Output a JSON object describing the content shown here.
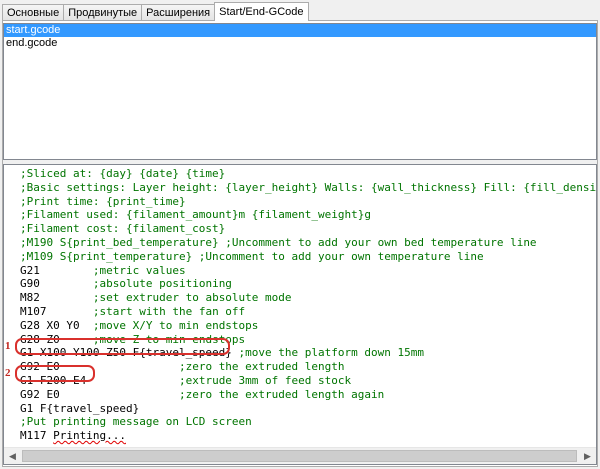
{
  "tabs": [
    {
      "label": "Основные",
      "active": false
    },
    {
      "label": "Продвинутые",
      "active": false
    },
    {
      "label": "Расширения",
      "active": false
    },
    {
      "label": "Start/End-GCode",
      "active": true
    }
  ],
  "files": [
    {
      "name": "start.gcode",
      "selected": true
    },
    {
      "name": "end.gcode",
      "selected": false
    }
  ],
  "code_lines": [
    {
      "code": "",
      "comment": ";Sliced at: {day} {date} {time}"
    },
    {
      "code": "",
      "comment": ";Basic settings: Layer height: {layer_height} Walls: {wall_thickness} Fill: {fill_density}"
    },
    {
      "code": "",
      "comment": ";Print time: {print_time}"
    },
    {
      "code": "",
      "comment": ";Filament used: {filament_amount}m {filament_weight}g"
    },
    {
      "code": "",
      "comment": ";Filament cost: {filament_cost}"
    },
    {
      "code": "",
      "comment": ";M190 S{print_bed_temperature} ;Uncomment to add your own bed temperature line"
    },
    {
      "code": "",
      "comment": ";M109 S{print_temperature} ;Uncomment to add your own temperature line"
    },
    {
      "code": "G21        ",
      "comment": ";metric values"
    },
    {
      "code": "G90        ",
      "comment": ";absolute positioning"
    },
    {
      "code": "M82        ",
      "comment": ";set extruder to absolute mode"
    },
    {
      "code": "M107       ",
      "comment": ";start with the fan off"
    },
    {
      "code": "G28 X0 Y0  ",
      "comment": ";move X/Y to min endstops"
    },
    {
      "code": "G28 Z0     ",
      "comment": ";move Z to min endstops"
    },
    {
      "code": "G1 X100 Y100 Z50 F{travel_speed} ",
      "comment": ";move the platform down 15mm"
    },
    {
      "code": "G92 E0                  ",
      "comment": ";zero the extruded length"
    },
    {
      "code": "G1 F200 E4              ",
      "comment": ";extrude 3mm of feed stock"
    },
    {
      "code": "G92 E0                  ",
      "comment": ";zero the extruded length again"
    },
    {
      "code": "G1 F{travel_speed}",
      "comment": ""
    },
    {
      "code": "",
      "comment": ";Put printing message on LCD screen"
    },
    {
      "code": "M117 ",
      "comment": "",
      "underlined": "Printing..."
    }
  ],
  "annotations": [
    {
      "number": "1",
      "target": "G1 X100 Y100 Z50 F{travel_speed}"
    },
    {
      "number": "2",
      "target": "G1 F200 E4"
    }
  ],
  "colors": {
    "comment": "#007400",
    "selection": "#3399ff",
    "annotation": "#d9302c"
  }
}
